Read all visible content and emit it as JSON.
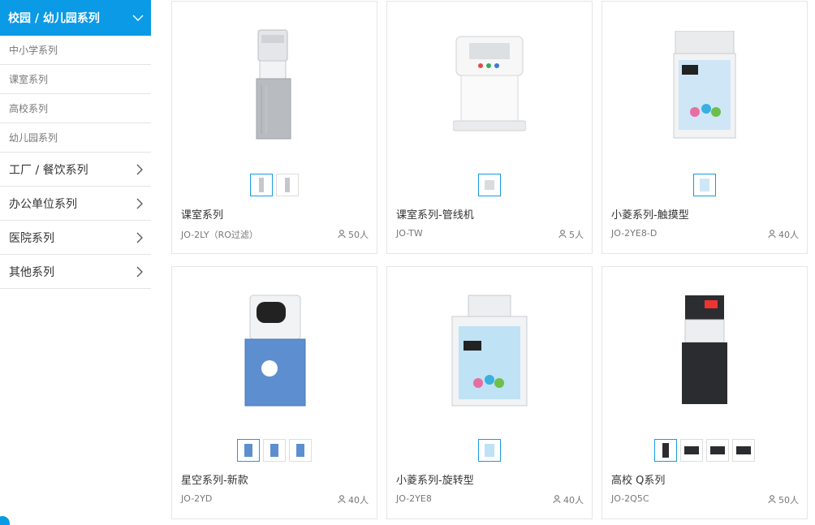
{
  "sidebar": {
    "active_category": "校园 / 幼儿园系列",
    "sub_items": [
      "中小学系列",
      "课室系列",
      "高校系列",
      "幼儿园系列"
    ],
    "categories": [
      "工厂 / 餐饮系列",
      "办公单位系列",
      "医院系列",
      "其他系列"
    ]
  },
  "products": [
    {
      "title": "课室系列",
      "model": "JO-2LY（RO过滤）",
      "users": "50人",
      "thumb_count": 2
    },
    {
      "title": "课室系列-管线机",
      "model": "JO-TW",
      "users": "5人",
      "thumb_count": 1
    },
    {
      "title": "小菱系列-触摸型",
      "model": "JO-2YE8-D",
      "users": "40人",
      "thumb_count": 1
    },
    {
      "title": "星空系列-新款",
      "model": "JO-2YD",
      "users": "40人",
      "thumb_count": 3
    },
    {
      "title": "小菱系列-旋转型",
      "model": "JO-2YE8",
      "users": "40人",
      "thumb_count": 1
    },
    {
      "title": "高校 Q系列",
      "model": "JO-2Q5C",
      "users": "50人",
      "thumb_count": 4
    }
  ],
  "colors": {
    "accent": "#0a9ae6",
    "thumb_active_border": "#1a9be0"
  },
  "icons": {
    "user": "user-icon",
    "chevron_right": "chevron-right-icon",
    "chevron_down": "chevron-down-icon"
  }
}
